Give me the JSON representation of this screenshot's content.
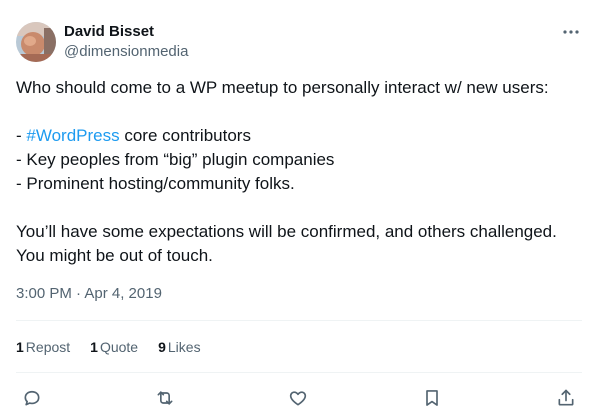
{
  "author": {
    "name": "David Bisset",
    "handle": "@dimensionmedia",
    "avatar_icon": "avatar"
  },
  "tweet": {
    "line1": "Who should come to a WP meetup to personally interact w/ new users:",
    "line2_prefix": "- ",
    "line2_hashtag": "#WordPress",
    "line2_suffix": " core contributors",
    "line3": "- Key peoples from “big” plugin companies",
    "line4": "- Prominent hosting/community folks.",
    "line5": "You’ll have some expectations will be confirmed, and others challenged.",
    "line6": "You might be out of touch."
  },
  "timestamp": "3:00 PM · Apr 4, 2019",
  "stats": {
    "reposts_count": "1",
    "reposts_label": "Repost",
    "quotes_count": "1",
    "quotes_label": "Quote",
    "likes_count": "9",
    "likes_label": "Likes"
  },
  "colors": {
    "text": "#0f1419",
    "secondary": "#536471",
    "link": "#1d9bf0",
    "divider": "#eff3f4"
  },
  "icons": {
    "more": "more-icon",
    "reply": "reply-icon",
    "repost": "repost-icon",
    "like": "like-icon",
    "bookmark": "bookmark-icon",
    "share": "share-icon"
  }
}
